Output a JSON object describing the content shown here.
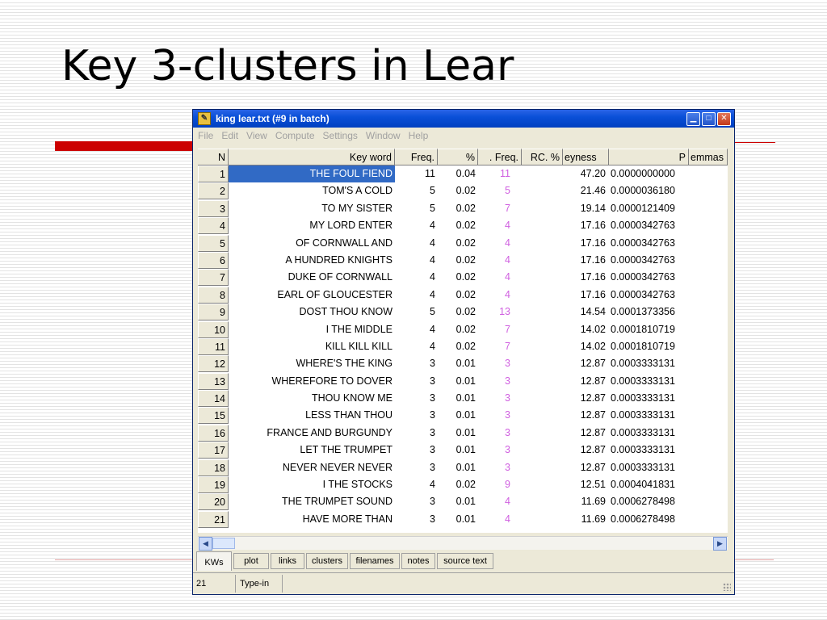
{
  "slide": {
    "title": "Key 3-clusters in Lear"
  },
  "window": {
    "title": "king lear.txt (#9 in batch)",
    "controls": [
      "minimize",
      "maximize",
      "close"
    ],
    "menu": [
      "File",
      "Edit",
      "View",
      "Compute",
      "Settings",
      "Window",
      "Help"
    ]
  },
  "table": {
    "headers": {
      "n": "N",
      "key_word": "Key word",
      "freq": "Freq.",
      "pct": "%",
      "rc_freq": ". Freq.",
      "rc_pct": "RC. %",
      "keyness": "eyness",
      "p": "P",
      "lemmas": "emmas"
    },
    "rows": [
      {
        "n": "1",
        "key_word": "THE FOUL FIEND",
        "freq": "11",
        "pct": "0.04",
        "rc_freq": "11",
        "keyness": "47.20",
        "p": "0.0000000000"
      },
      {
        "n": "2",
        "key_word": "TOM'S A COLD",
        "freq": "5",
        "pct": "0.02",
        "rc_freq": "5",
        "keyness": "21.46",
        "p": "0.0000036180"
      },
      {
        "n": "3",
        "key_word": "TO MY SISTER",
        "freq": "5",
        "pct": "0.02",
        "rc_freq": "7",
        "keyness": "19.14",
        "p": "0.0000121409"
      },
      {
        "n": "4",
        "key_word": "MY LORD ENTER",
        "freq": "4",
        "pct": "0.02",
        "rc_freq": "4",
        "keyness": "17.16",
        "p": "0.0000342763"
      },
      {
        "n": "5",
        "key_word": "OF CORNWALL AND",
        "freq": "4",
        "pct": "0.02",
        "rc_freq": "4",
        "keyness": "17.16",
        "p": "0.0000342763"
      },
      {
        "n": "6",
        "key_word": "A HUNDRED KNIGHTS",
        "freq": "4",
        "pct": "0.02",
        "rc_freq": "4",
        "keyness": "17.16",
        "p": "0.0000342763"
      },
      {
        "n": "7",
        "key_word": "DUKE OF CORNWALL",
        "freq": "4",
        "pct": "0.02",
        "rc_freq": "4",
        "keyness": "17.16",
        "p": "0.0000342763"
      },
      {
        "n": "8",
        "key_word": "EARL OF GLOUCESTER",
        "freq": "4",
        "pct": "0.02",
        "rc_freq": "4",
        "keyness": "17.16",
        "p": "0.0000342763"
      },
      {
        "n": "9",
        "key_word": "DOST THOU KNOW",
        "freq": "5",
        "pct": "0.02",
        "rc_freq": "13",
        "keyness": "14.54",
        "p": "0.0001373356"
      },
      {
        "n": "10",
        "key_word": "I THE MIDDLE",
        "freq": "4",
        "pct": "0.02",
        "rc_freq": "7",
        "keyness": "14.02",
        "p": "0.0001810719"
      },
      {
        "n": "11",
        "key_word": "KILL KILL KILL",
        "freq": "4",
        "pct": "0.02",
        "rc_freq": "7",
        "keyness": "14.02",
        "p": "0.0001810719"
      },
      {
        "n": "12",
        "key_word": "WHERE'S THE KING",
        "freq": "3",
        "pct": "0.01",
        "rc_freq": "3",
        "keyness": "12.87",
        "p": "0.0003333131"
      },
      {
        "n": "13",
        "key_word": "WHEREFORE TO DOVER",
        "freq": "3",
        "pct": "0.01",
        "rc_freq": "3",
        "keyness": "12.87",
        "p": "0.0003333131"
      },
      {
        "n": "14",
        "key_word": "THOU KNOW ME",
        "freq": "3",
        "pct": "0.01",
        "rc_freq": "3",
        "keyness": "12.87",
        "p": "0.0003333131"
      },
      {
        "n": "15",
        "key_word": "LESS THAN THOU",
        "freq": "3",
        "pct": "0.01",
        "rc_freq": "3",
        "keyness": "12.87",
        "p": "0.0003333131"
      },
      {
        "n": "16",
        "key_word": "FRANCE AND BURGUNDY",
        "freq": "3",
        "pct": "0.01",
        "rc_freq": "3",
        "keyness": "12.87",
        "p": "0.0003333131"
      },
      {
        "n": "17",
        "key_word": "LET THE TRUMPET",
        "freq": "3",
        "pct": "0.01",
        "rc_freq": "3",
        "keyness": "12.87",
        "p": "0.0003333131"
      },
      {
        "n": "18",
        "key_word": "NEVER NEVER NEVER",
        "freq": "3",
        "pct": "0.01",
        "rc_freq": "3",
        "keyness": "12.87",
        "p": "0.0003333131"
      },
      {
        "n": "19",
        "key_word": "I THE STOCKS",
        "freq": "4",
        "pct": "0.02",
        "rc_freq": "9",
        "keyness": "12.51",
        "p": "0.0004041831"
      },
      {
        "n": "20",
        "key_word": "THE TRUMPET SOUND",
        "freq": "3",
        "pct": "0.01",
        "rc_freq": "4",
        "keyness": "11.69",
        "p": "0.0006278498"
      },
      {
        "n": "21",
        "key_word": "HAVE MORE THAN",
        "freq": "3",
        "pct": "0.01",
        "rc_freq": "4",
        "keyness": "11.69",
        "p": "0.0006278498"
      }
    ]
  },
  "tabs": [
    "KWs",
    "plot",
    "links",
    "clusters",
    "filenames",
    "notes",
    "source text"
  ],
  "active_tab": "KWs",
  "status": {
    "count": "21",
    "mode": "Type-in"
  },
  "colors": {
    "selection": "#316ac5",
    "rc_freq_text": "#d060e0",
    "accent_red": "#cc0000",
    "titlebar": "#0a50d8"
  }
}
